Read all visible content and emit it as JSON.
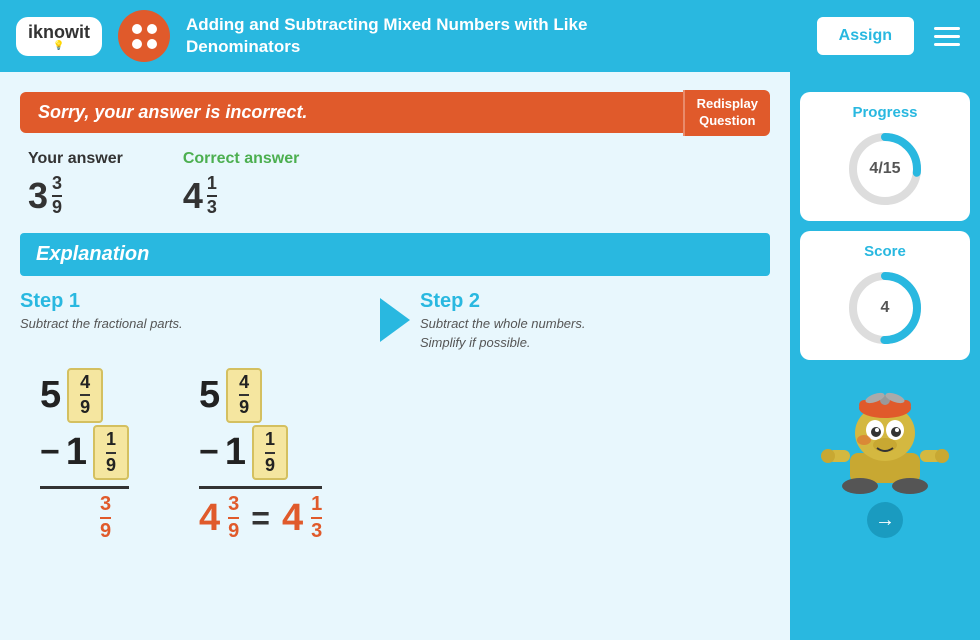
{
  "header": {
    "title_line1": "Adding and Subtracting Mixed Numbers with Like",
    "title_line2": "Denominators",
    "assign_label": "Assign",
    "logo_text": "iknowit"
  },
  "feedback": {
    "incorrect_message": "Sorry, your answer is incorrect.",
    "redisplay_label": "Redisplay\nQuestion"
  },
  "your_answer": {
    "label": "Your answer",
    "whole": "3",
    "numerator": "3",
    "denominator": "9"
  },
  "correct_answer": {
    "label": "Correct answer",
    "whole": "4",
    "numerator": "1",
    "denominator": "3"
  },
  "explanation": {
    "title": "Explanation",
    "step1_title": "Step 1",
    "step1_desc": "Subtract the fractional parts.",
    "step2_title": "Step 2",
    "step2_desc": "Subtract the whole numbers.\nSimplify if possible."
  },
  "math_step1": {
    "top_whole": "5",
    "top_frac_num": "4",
    "top_frac_den": "9",
    "bottom_sign": "−",
    "bottom_whole": "1",
    "bottom_frac_num": "1",
    "bottom_frac_den": "9",
    "result_frac_num": "3",
    "result_frac_den": "9"
  },
  "math_step2": {
    "top_whole": "5",
    "top_frac_num": "4",
    "top_frac_den": "9",
    "bottom_sign": "−",
    "bottom_whole": "1",
    "bottom_frac_num": "1",
    "bottom_frac_den": "9",
    "result_whole": "4",
    "result_frac_num": "3",
    "result_frac_den": "9",
    "equals": "=",
    "final_whole": "4",
    "final_frac_num": "1",
    "final_frac_den": "3"
  },
  "sidebar": {
    "progress_title": "Progress",
    "progress_current": "4",
    "progress_total": "15",
    "progress_label": "4/15",
    "score_title": "Score",
    "score_value": "4",
    "progress_percent": 27
  }
}
